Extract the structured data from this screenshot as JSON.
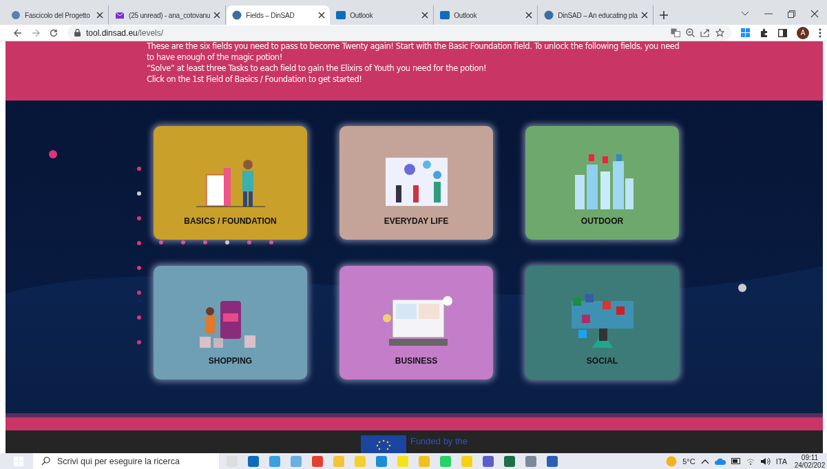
{
  "browser": {
    "tabs": [
      {
        "title": "Fascicolo del Progetto",
        "selected": false
      },
      {
        "title": "(25 unread) - ana_cotovanu",
        "selected": false
      },
      {
        "title": "Fields – DinSAD",
        "selected": true
      },
      {
        "title": "Outlook",
        "selected": false
      },
      {
        "title": "Outlook",
        "selected": false
      },
      {
        "title": "DinSAD – An educating pla",
        "selected": false
      }
    ],
    "url_host": "tool.dinsad.eu",
    "url_path": "/levels/",
    "profile_initial": "A"
  },
  "intro": [
    "These are the six fields you need to pass to become Twenty again! Start with the Basic Foundation field. To unlock the following fields, you need to have enough of the magic potion!",
    "“Solve” at least three Tasks to each field to gain the Elixirs of Youth you need for the potion!",
    "Click on the 1st Field of Basics / Foundation to get started!"
  ],
  "fields": [
    {
      "label": "BASICS / FOUNDATION",
      "color": "#c9a02a"
    },
    {
      "label": "EVERYDAY LIFE",
      "color": "#c4a398"
    },
    {
      "label": "OUTDOOR",
      "color": "#6ea86c"
    },
    {
      "label": "SHOPPING",
      "color": "#6f9fb5"
    },
    {
      "label": "BUSINESS",
      "color": "#c47dc9"
    },
    {
      "label": "SOCIAL",
      "color": "#3c7b78"
    }
  ],
  "footer": {
    "funding": "Funded by the"
  },
  "taskbar": {
    "search_placeholder": "Scrivi qui per eseguire la ricerca",
    "temperature": "5°C",
    "language": "ITA",
    "time": "09:11",
    "date": "24/02/202"
  }
}
